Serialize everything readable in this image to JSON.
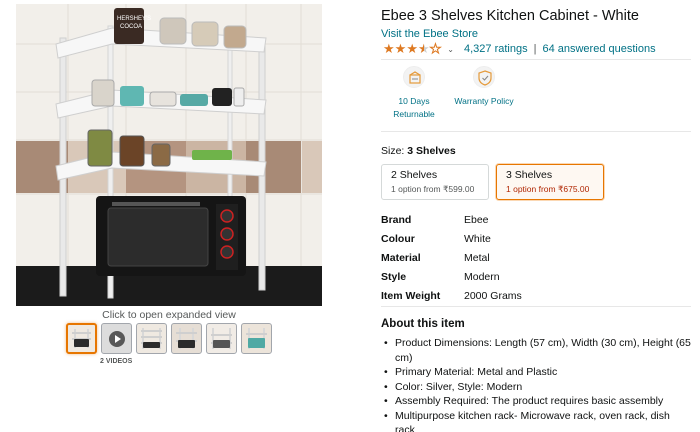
{
  "gallery": {
    "click_hint": "Click to open expanded view",
    "videos_label": "2 VIDEOS",
    "image_text": {
      "jar_label_1": "HERSHEY'S",
      "jar_label_2": "COCOA"
    },
    "thumbnails": [
      {
        "kind": "image",
        "active": true
      },
      {
        "kind": "video",
        "active": false
      },
      {
        "kind": "image",
        "active": false
      },
      {
        "kind": "image",
        "active": false
      },
      {
        "kind": "image",
        "active": false
      },
      {
        "kind": "image",
        "active": false
      }
    ]
  },
  "product": {
    "title": "Ebee 3 Shelves Kitchen Cabinet - White",
    "store_link": "Visit the Ebee Store",
    "rating": 3.5,
    "ratings_count": "4,327 ratings",
    "separator": "|",
    "answered": "64 answered questions"
  },
  "badges": [
    {
      "icon": "return-box-icon",
      "line1": "10 Days",
      "line2": "Returnable"
    },
    {
      "icon": "shield-check-icon",
      "line1": "Warranty Policy",
      "line2": ""
    }
  ],
  "size": {
    "label": "Size:",
    "selected": "3 Shelves",
    "options": [
      {
        "name": "2 Shelves",
        "price": "1 option from ₹599.00",
        "selected": false
      },
      {
        "name": "3 Shelves",
        "price": "1 option from ₹675.00",
        "selected": true
      }
    ]
  },
  "specs": [
    {
      "key": "Brand",
      "value": "Ebee"
    },
    {
      "key": "Colour",
      "value": "White"
    },
    {
      "key": "Material",
      "value": "Metal"
    },
    {
      "key": "Style",
      "value": "Modern"
    },
    {
      "key": "Item Weight",
      "value": "2000 Grams"
    }
  ],
  "about": {
    "title": "About this item",
    "bullets": [
      "Product Dimensions: Length (57 cm), Width (30 cm), Height (65 cm)",
      "Primary Material: Metal and Plastic",
      "Color: Silver, Style: Modern",
      "Assembly Required: The product requires basic assembly",
      "Multipurpose kitchen rack- Microwave rack, oven rack, dish rack"
    ]
  },
  "colors": {
    "link": "#007185",
    "star": "#de7921",
    "selected_border": "#e77600",
    "price_red": "#b12704"
  }
}
